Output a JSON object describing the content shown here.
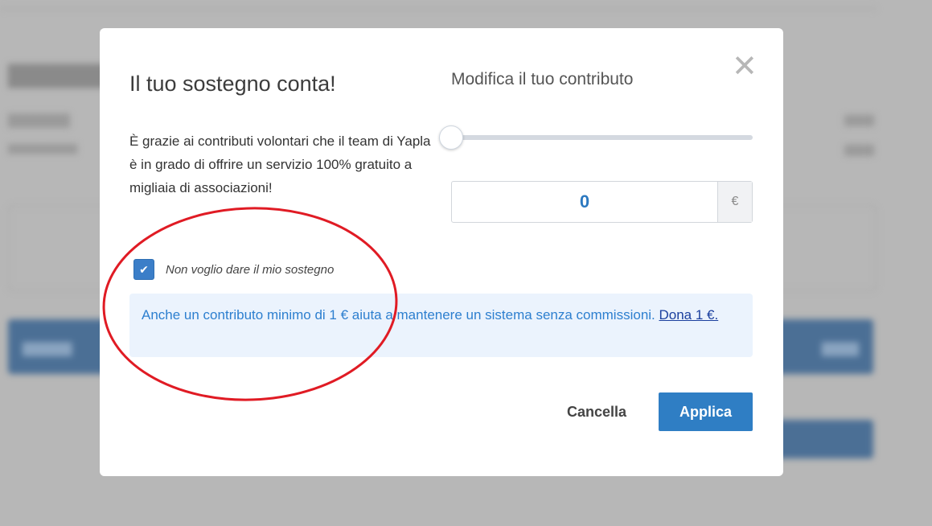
{
  "modal": {
    "title": "Il tuo sostegno conta!",
    "description": "È grazie ai contributi volontari che il team di Yapla è in grado di offrire un servizio 100% gratuito a migliaia di associazioni!",
    "contribution_title": "Modifica il tuo contributo",
    "slider_value_fraction": 0,
    "amount_value": "0",
    "currency_symbol": "€",
    "checkbox_checked": true,
    "checkbox_label": "Non voglio dare il mio sostegno",
    "info_text": "Anche un contributo minimo di 1 € aiuta a mantenere un sistema senza commissioni. ",
    "info_link_text": "Dona 1 €.",
    "cancel_label": "Cancella",
    "apply_label": "Applica",
    "close_symbol": "✕"
  },
  "colors": {
    "overlay": "#b7b7b7",
    "accent": "#2f7ec4",
    "info_bg": "#ebf3fd",
    "info_text": "#2d7fcf",
    "annotation": "#e01b24"
  }
}
